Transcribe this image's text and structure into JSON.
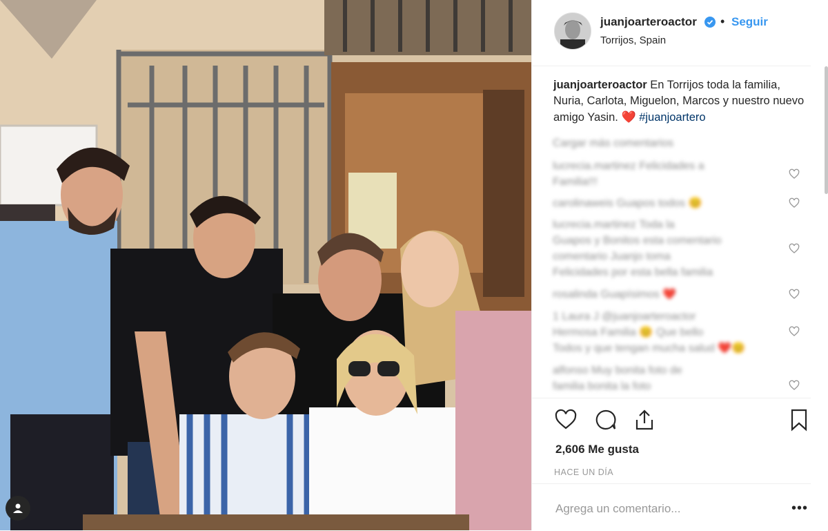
{
  "post": {
    "username": "juanjoarteroactor",
    "verified_icon": "verified-badge-icon",
    "separator": "•",
    "follow_label": "Seguir",
    "location": "Torrijos, Spain",
    "caption_text": " En Torrijos toda la familia, Nuria, Carlota, Miguelon, Marcos y nuestro nuevo amigo Yasin. ",
    "caption_emoji": "❤️",
    "caption_hashtag": "#juanjoartero",
    "likes_text": "2,606 Me gusta",
    "time_text": "HACE UN DÍA",
    "comment_placeholder": "Agrega un comentario...",
    "more_label": "•••"
  },
  "comments": [
    {
      "lines": [
        "Cargar más comentarios"
      ]
    },
    {
      "lines": [
        "lucrecia.martinez Felicidades a",
        "Familia!!!"
      ]
    },
    {
      "lines": [
        "carolinaweis Guapos todos 😊"
      ]
    },
    {
      "lines": [
        "lucrecia.martinez Toda la",
        "Guapos y Bonitos esta comentario",
        "comentario Juanjo toma",
        "Felicidades por esta bella familia"
      ]
    },
    {
      "lines": [
        "rosalinda Guapísimos ❤️"
      ]
    },
    {
      "lines": [
        "1 Laura J @juanjoarteroactor",
        "Hermosa Familia 😊 Que bello",
        "Todos y que tengan mucha salud ❤️😊"
      ]
    },
    {
      "lines": [
        "alfonso Muy bonita foto de",
        "familia bonita la foto"
      ]
    }
  ],
  "icons": {
    "like": "heart-icon",
    "comment": "comment-bubble-icon",
    "share": "share-icon",
    "save": "bookmark-icon",
    "user_tag": "person-icon"
  },
  "colors": {
    "accent": "#3897f0",
    "hashtag": "#003569",
    "secondary_text": "#8e8e8e"
  }
}
